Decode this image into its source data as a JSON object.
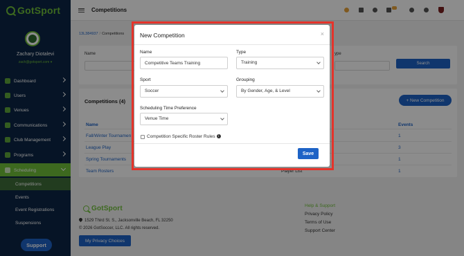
{
  "app": {
    "logo": "GotSport"
  },
  "user": {
    "name": "Zachary Diotalevi",
    "email": "zach@gotsport.com ▾"
  },
  "sidebar": {
    "items": [
      {
        "label": "Dashboard",
        "icon": "dashboard-icon"
      },
      {
        "label": "Users",
        "icon": "users-icon"
      },
      {
        "label": "Venues",
        "icon": "venues-icon"
      },
      {
        "label": "Communications",
        "icon": "communications-icon"
      },
      {
        "label": "Club Management",
        "icon": "club-icon"
      },
      {
        "label": "Programs",
        "icon": "programs-icon"
      },
      {
        "label": "Scheduling",
        "icon": "scheduling-icon"
      }
    ],
    "subitems": [
      {
        "label": "Competitions"
      },
      {
        "label": "Events"
      },
      {
        "label": "Event Registrations"
      },
      {
        "label": "Suspensions"
      }
    ],
    "support_label": "Support"
  },
  "topbar": {
    "title": "Competitions"
  },
  "breadcrumb": {
    "id": "13L384937",
    "current": "Competitions"
  },
  "filters": {
    "name_label": "Name",
    "type_label": "ype",
    "search_label": "Search"
  },
  "list": {
    "title": "Competitions (4)",
    "new_button": "+ New Competition",
    "headers": {
      "name": "Name",
      "events": "Events"
    },
    "rows": [
      {
        "name": "Fall/Winter Tournamen",
        "mid": "",
        "events": "1"
      },
      {
        "name": "League Play",
        "mid": "",
        "events": "3"
      },
      {
        "name": "Spring Tournaments",
        "mid": "",
        "events": "1"
      },
      {
        "name": "Team Rosters",
        "mid": "Player List",
        "events": "1"
      }
    ]
  },
  "footer": {
    "logo": "GotSport",
    "address": "1529 Third St. S., Jacksonville Beach, FL 32250",
    "copyright": "© 2026 GotSoccer, LLC. All rights reserved.",
    "privacy_btn": "My Privacy Choices",
    "help_title": "Help & Support",
    "links": [
      "Privacy Policy",
      "Terms of Use",
      "Support Center"
    ]
  },
  "modal": {
    "title": "New Competition",
    "close": "×",
    "name_label": "Name",
    "name_value": "Competitive Teams Training",
    "type_label": "Type",
    "type_value": "Training",
    "sport_label": "Sport",
    "sport_value": "Soccer",
    "grouping_label": "Grouping",
    "grouping_value": "By Gender, Age, & Level",
    "time_label": "Scheduling Time Preference",
    "time_value": "Venue Time",
    "checkbox_label": "Competition Specific Roster Rules",
    "checkbox_checked": false,
    "save_label": "Save"
  },
  "colors": {
    "brand_green": "#6fbf3a",
    "navy": "#0b2545",
    "blue": "#1e63c6",
    "highlight_red": "#e5332a"
  }
}
